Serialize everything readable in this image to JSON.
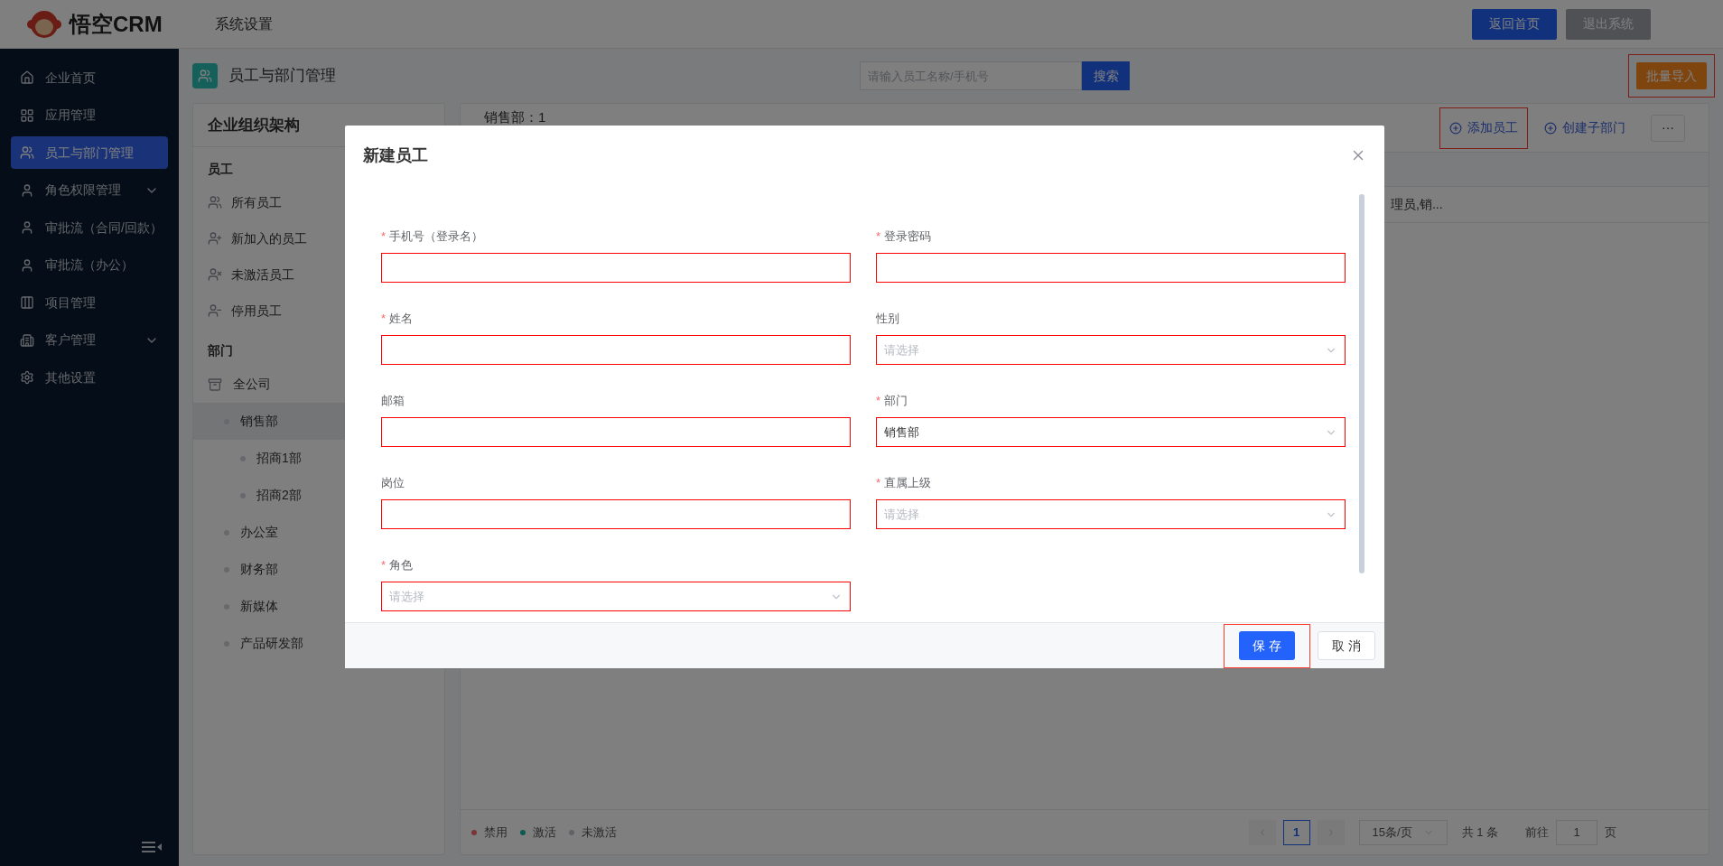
{
  "header": {
    "logo_text": "悟空CRM",
    "section": "系统设置",
    "buttons": [
      {
        "label": "返回首页",
        "kind": "primary"
      },
      {
        "label": "退出系统",
        "kind": "disabled"
      }
    ]
  },
  "sidebar": {
    "items": [
      {
        "label": "企业首页",
        "selected": false,
        "expandable": false
      },
      {
        "label": "应用管理",
        "selected": false,
        "expandable": false
      },
      {
        "label": "员工与部门管理",
        "selected": true,
        "expandable": false
      },
      {
        "label": "角色权限管理",
        "selected": false,
        "expandable": true
      },
      {
        "label": "审批流（合同/回款）",
        "selected": false,
        "expandable": false
      },
      {
        "label": "审批流（办公）",
        "selected": false,
        "expandable": false
      },
      {
        "label": "项目管理",
        "selected": false,
        "expandable": false
      },
      {
        "label": "客户管理",
        "selected": false,
        "expandable": true
      },
      {
        "label": "其他设置",
        "selected": false,
        "expandable": false
      }
    ]
  },
  "page": {
    "title": "员工与部门管理",
    "search": {
      "placeholder": "请输入员工名称/手机号",
      "button": "搜索"
    },
    "import_button": {
      "label": "批量导入",
      "highlighted": true
    }
  },
  "org_panel": {
    "title": "企业组织架构",
    "employee_heading": "员工",
    "employee_items": [
      {
        "label": "所有员工",
        "selected": false
      },
      {
        "label": "新加入的员工",
        "selected": false
      },
      {
        "label": "未激活员工",
        "selected": false
      },
      {
        "label": "停用员工",
        "selected": false
      }
    ],
    "department_heading": "部门",
    "departments": [
      {
        "label": "全公司",
        "selected": false,
        "children": [
          {
            "label": "销售部",
            "selected": true,
            "children": [
              {
                "label": "招商1部",
                "selected": false
              },
              {
                "label": "招商2部",
                "selected": false
              }
            ]
          },
          {
            "label": "办公室",
            "selected": false
          },
          {
            "label": "财务部",
            "selected": false
          },
          {
            "label": "新媒体",
            "selected": false
          },
          {
            "label": "产品研发部",
            "selected": false
          }
        ]
      }
    ]
  },
  "dept_panel": {
    "title": "销售部：1",
    "actions": [
      {
        "label": "添加员工",
        "highlighted": true
      },
      {
        "label": "创建子部门",
        "highlighted": false
      }
    ],
    "more": "···",
    "row_text": "理员,销...",
    "legend": [
      {
        "label": "禁用",
        "color": "#7a3636"
      },
      {
        "label": "激活",
        "color": "#0c5a52"
      },
      {
        "label": "未激活",
        "color": "#606266"
      }
    ],
    "pagination": {
      "pages": [
        {
          "label": "1",
          "selected": true
        }
      ],
      "page_size": "15条/页",
      "total": "共 1 条",
      "goto_label": "前往",
      "goto_value": "1",
      "goto_suffix": "页"
    }
  },
  "dialog": {
    "title": "新建员工",
    "fields": [
      {
        "label": "手机号（登录名）",
        "required_mark": "*",
        "kind": "input",
        "highlighted": true
      },
      {
        "label": "登录密码",
        "required_mark": "*",
        "kind": "input",
        "highlighted": true
      },
      {
        "label": "姓名",
        "required_mark": "*",
        "kind": "input",
        "highlighted": true
      },
      {
        "label": "性别",
        "kind": "select",
        "placeholder": "请选择",
        "highlighted": true
      },
      {
        "label": "邮箱",
        "kind": "input",
        "highlighted": true
      },
      {
        "label": "部门",
        "required_mark": "*",
        "kind": "select",
        "value": "销售部",
        "highlighted": true
      },
      {
        "label": "岗位",
        "kind": "input",
        "highlighted": true
      },
      {
        "label": "直属上级",
        "required_mark": "*",
        "kind": "select",
        "placeholder": "请选择",
        "highlighted": true
      },
      {
        "label": "角色",
        "required_mark": "*",
        "kind": "select",
        "placeholder": "请选择",
        "highlighted": true
      }
    ],
    "buttons": [
      {
        "label": "保 存",
        "kind": "primary",
        "highlighted": true
      },
      {
        "label": "取 消",
        "kind": "default",
        "highlighted": false
      }
    ]
  }
}
